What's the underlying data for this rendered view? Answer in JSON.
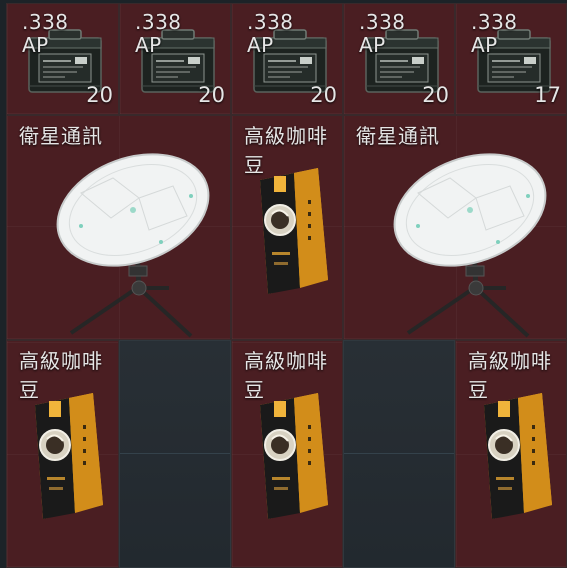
{
  "inventory": {
    "row1": [
      {
        "caliber_top": ".338",
        "caliber_bottom": "AP",
        "count": "20",
        "icon": "ammo-box-icon"
      },
      {
        "caliber_top": ".338",
        "caliber_bottom": "AP",
        "count": "20",
        "icon": "ammo-box-icon"
      },
      {
        "caliber_top": ".338",
        "caliber_bottom": "AP",
        "count": "20",
        "icon": "ammo-box-icon"
      },
      {
        "caliber_top": ".338",
        "caliber_bottom": "AP",
        "count": "20",
        "icon": "ammo-box-icon"
      },
      {
        "caliber_top": ".338",
        "caliber_bottom": "AP",
        "count": "17",
        "icon": "ammo-box-icon"
      }
    ],
    "satellite_1": {
      "name": "衛星通訊",
      "icon": "satellite-dish-icon"
    },
    "coffee_1": {
      "name": "高級咖啡豆",
      "icon": "coffee-bag-icon"
    },
    "satellite_2": {
      "name": "衛星通訊",
      "icon": "satellite-dish-icon"
    },
    "coffee_2": {
      "name": "高級咖啡豆",
      "icon": "coffee-bag-icon"
    },
    "coffee_3": {
      "name": "高級咖啡豆",
      "icon": "coffee-bag-icon"
    },
    "coffee_4": {
      "name": "高級咖啡豆",
      "icon": "coffee-bag-icon"
    }
  },
  "colors": {
    "slot_background": "#4a1e22",
    "empty_slot": "#242b31",
    "text": "#e6e6e6"
  }
}
